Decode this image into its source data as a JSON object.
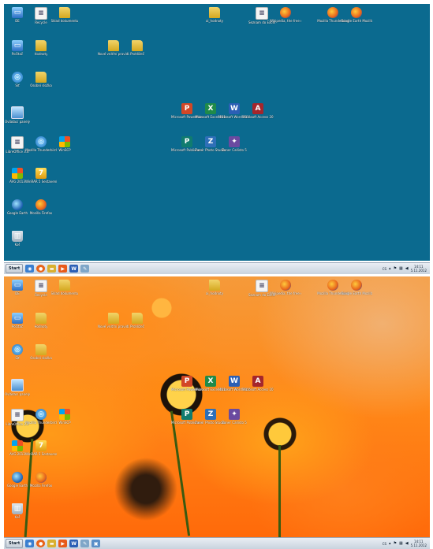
{
  "screen_top": {
    "icons": [
      {
        "label": "DE",
        "glyph": "computer-icon"
      },
      {
        "label": "Recycle",
        "glyph": "document-icon"
      },
      {
        "label": "Sklad dokumentu",
        "glyph": "folder-icon"
      },
      {
        "label": "ai_hodnoty",
        "glyph": "folder-icon"
      },
      {
        "label": "Seznam do Excel",
        "glyph": "document-icon"
      },
      {
        "label": "Wikipedia, the free encyclo...",
        "glyph": "firefox-icon"
      },
      {
        "label": "Mozilla Thunderbird",
        "glyph": "firefox-icon"
      },
      {
        "label": "Google Earth Mozilla Firefox",
        "glyph": "firefox-icon"
      },
      {
        "label": "Počítač",
        "glyph": "computer-icon"
      },
      {
        "label": "Hodnoty",
        "glyph": "folder-icon"
      },
      {
        "label": "Nové vnitřní pravidla",
        "glyph": "folder-icon"
      },
      {
        "label": "Prohlížeč",
        "glyph": "folder-icon"
      },
      {
        "label": "Síť",
        "glyph": "network-icon"
      },
      {
        "label": "Osobní složka",
        "glyph": "folder-icon"
      },
      {
        "label": "Ovládací panely",
        "glyph": "monitor-icon"
      },
      {
        "label": "Microsoft PowerPoint",
        "glyph": "powerpoint-icon"
      },
      {
        "label": "Microsoft Excel 2010",
        "glyph": "excel-icon"
      },
      {
        "label": "Microsoft Word 2010",
        "glyph": "word-icon"
      },
      {
        "label": "Microsoft Access 2010",
        "glyph": "access-icon"
      },
      {
        "label": "LibreOffice 3.6",
        "glyph": "document-icon"
      },
      {
        "label": "Mozilla Thunderbird",
        "glyph": "network-icon"
      },
      {
        "label": "WinSCP",
        "glyph": "windows-icon"
      },
      {
        "label": "Microsoft Publisher 2010",
        "glyph": "publisher-icon"
      },
      {
        "label": "Zoner Photo Studio 15 Home",
        "glyph": "photo-icon"
      },
      {
        "label": "Zoner Callisto 5",
        "glyph": "butterfly-icon"
      },
      {
        "label": "AVG 2013",
        "glyph": "windows-icon"
      },
      {
        "label": "WinRAR 5 Sestavení",
        "glyph": "sp-icon"
      },
      {
        "label": "Google Earth",
        "glyph": "earth-icon"
      },
      {
        "label": "Mozilla Firefox",
        "glyph": "firefox-icon"
      },
      {
        "label": "Koš",
        "glyph": "bin-icon"
      }
    ],
    "taskbar": {
      "start": "Start",
      "tray_lang": "CS",
      "time": "14:11",
      "date": "5.11.2012"
    }
  },
  "screen_bottom": {
    "icons": [
      {
        "label": "DE",
        "glyph": "computer-icon"
      },
      {
        "label": "Recycle",
        "glyph": "document-icon"
      },
      {
        "label": "Sklad dokumentu",
        "glyph": "folder-icon"
      },
      {
        "label": "ai_hodnoty",
        "glyph": "folder-icon"
      },
      {
        "label": "Seznam do Excel",
        "glyph": "document-icon"
      },
      {
        "label": "Wikipedia, the free encyclo...",
        "glyph": "firefox-icon"
      },
      {
        "label": "Mozilla Thunderbird",
        "glyph": "firefox-icon"
      },
      {
        "label": "Google Earth Mozilla Firefox",
        "glyph": "firefox-icon"
      },
      {
        "label": "Počítač",
        "glyph": "computer-icon"
      },
      {
        "label": "Hodnoty",
        "glyph": "folder-icon"
      },
      {
        "label": "Nové vnitřní pravidla",
        "glyph": "folder-icon"
      },
      {
        "label": "Prohlížeč",
        "glyph": "folder-icon"
      },
      {
        "label": "Síť",
        "glyph": "network-icon"
      },
      {
        "label": "Osobní složka",
        "glyph": "folder-icon"
      },
      {
        "label": "Ovládací panely",
        "glyph": "monitor-icon"
      },
      {
        "label": "Microsoft PowerPoint",
        "glyph": "powerpoint-icon"
      },
      {
        "label": "Microsoft Excel 2010",
        "glyph": "excel-icon"
      },
      {
        "label": "Microsoft Word 2010",
        "glyph": "word-icon"
      },
      {
        "label": "Microsoft Access 2010",
        "glyph": "access-icon"
      },
      {
        "label": "LibreOffice 3.6",
        "glyph": "document-icon"
      },
      {
        "label": "Mozilla Thunderbird",
        "glyph": "network-icon"
      },
      {
        "label": "WinSCP",
        "glyph": "windows-icon"
      },
      {
        "label": "Microsoft Publisher 2010",
        "glyph": "publisher-icon"
      },
      {
        "label": "Zoner Photo Studio 15 Home",
        "glyph": "photo-icon"
      },
      {
        "label": "Zoner Callisto 5",
        "glyph": "butterfly-icon"
      },
      {
        "label": "AVG 2013",
        "glyph": "windows-icon"
      },
      {
        "label": "WinRAR 5 Sestavení",
        "glyph": "sp-icon"
      },
      {
        "label": "Google Earth",
        "glyph": "earth-icon"
      },
      {
        "label": "Mozilla Firefox",
        "glyph": "firefox-icon"
      },
      {
        "label": "Koš",
        "glyph": "bin-icon"
      }
    ],
    "taskbar": {
      "start": "Start",
      "tray_lang": "CS",
      "time": "14:11",
      "date": "5.11.2012"
    }
  },
  "colors": {
    "desktop_blue": "#0b6a8f",
    "taskbar": "#d8e0e9"
  }
}
